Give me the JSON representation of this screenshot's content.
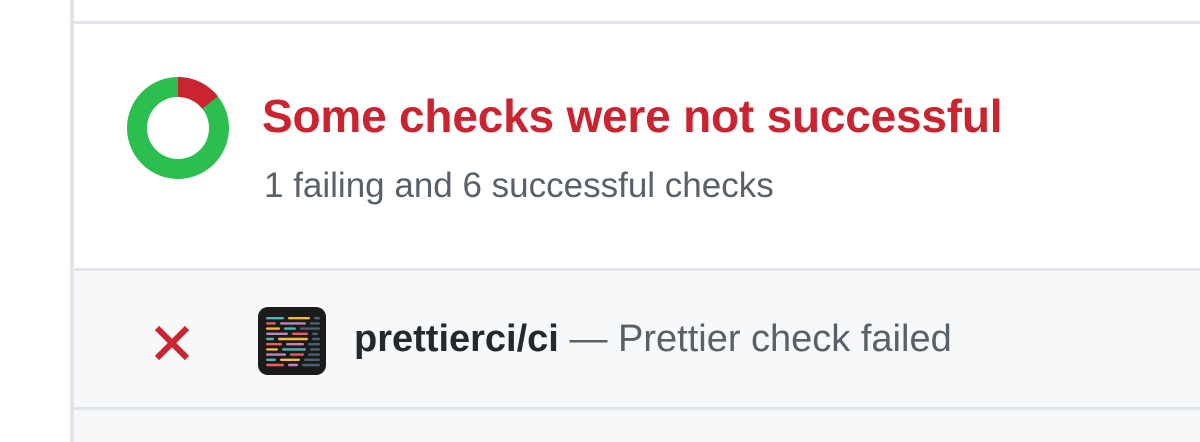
{
  "summary": {
    "title": "Some checks were not successful",
    "subtitle": "1 failing and 6 successful checks",
    "failing_count": 1,
    "successful_count": 6,
    "title_color": "#cb2431",
    "success_color": "#2cbe4e",
    "failure_color": "#cb2431"
  },
  "checks": [
    {
      "name": "prettierci/ci",
      "separator": "—",
      "description": "Prettier check failed",
      "status": "failure",
      "status_icon": "x-icon",
      "app_icon": "prettier-ci-logo-icon"
    }
  ],
  "colors": {
    "border": "#e1e4e8",
    "row_background": "#f6f8fa",
    "muted_text": "#586069",
    "primary_text": "#24292e"
  }
}
